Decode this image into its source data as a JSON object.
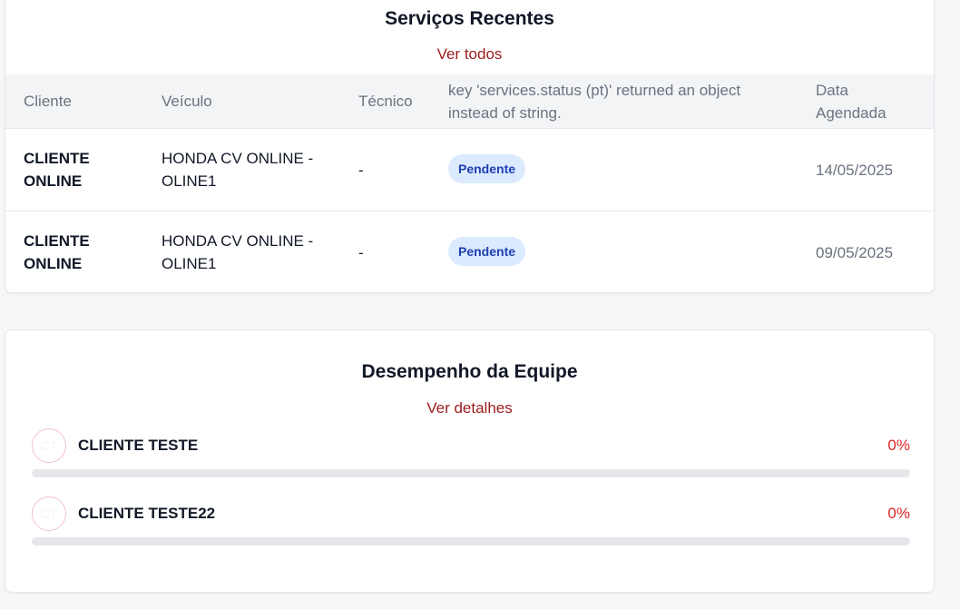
{
  "services": {
    "title": "Serviços Recentes",
    "view_all": "Ver todos",
    "columns": [
      "Cliente",
      "Veículo",
      "Técnico",
      "key 'services.status (pt)' returned an object instead of string.",
      "Data Agendada"
    ],
    "rows": [
      {
        "client": "CLIENTE ONLINE",
        "vehicle": "HONDA CV ONLINE - OLINE1",
        "technician": "-",
        "status": "Pendente",
        "date": "14/05/2025"
      },
      {
        "client": "CLIENTE ONLINE",
        "vehicle": "HONDA CV ONLINE - OLINE1",
        "technician": "-",
        "status": "Pendente",
        "date": "09/05/2025"
      }
    ]
  },
  "team": {
    "title": "Desempenho da Equipe",
    "view_details": "Ver detalhes",
    "members": [
      {
        "initials": "CT",
        "name": "CLIENTE TESTE",
        "percent_label": "0%",
        "progress": 0
      },
      {
        "initials": "CT",
        "name": "CLIENTE TESTE22",
        "percent_label": "0%",
        "progress": 0
      }
    ]
  },
  "colors": {
    "accent": "#9b1c1c",
    "badge_bg": "#dbeafe",
    "badge_text": "#1e40af",
    "percent": "#dc2626"
  }
}
